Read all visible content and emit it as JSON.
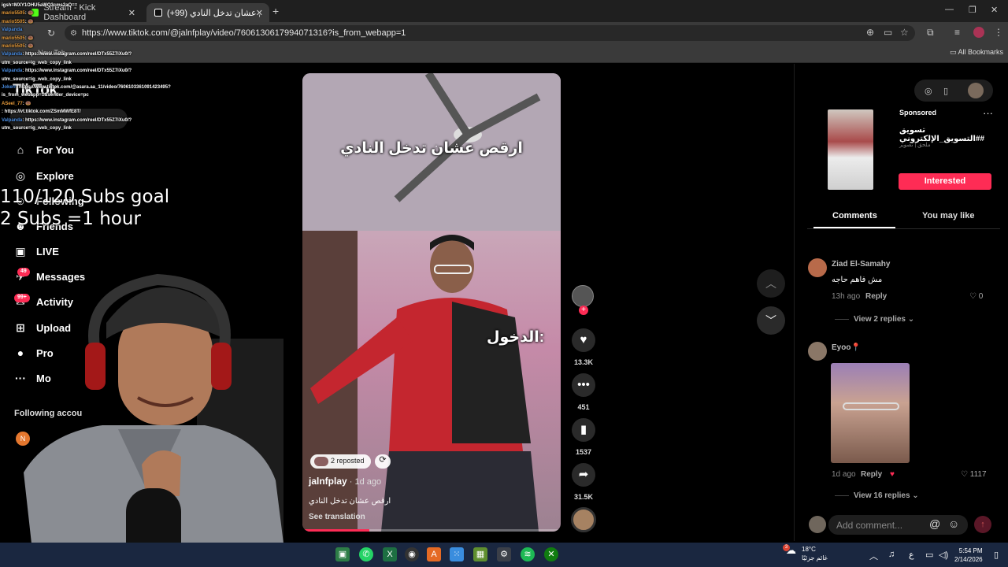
{
  "browser": {
    "tabs": [
      {
        "title": "Stream - Kick Dashboard",
        "favicon_color": "#53fc18"
      },
      {
        "title": "ارقص عشان تدخل النادي (99+) |",
        "favicon_color": "#111111"
      }
    ],
    "url": "https://www.tiktok.com/@jalnfplay/video/7606130617994071316?is_from_webapp=1",
    "bookmarks": {
      "new_tab": "New Tab",
      "all": "All Bookmarks"
    }
  },
  "chat": [
    {
      "nick": "",
      "text": "igsh=MXY1OHU5aWQ3cms2aQ=="
    },
    {
      "nick": "mario5505",
      "text": ": 🍩"
    },
    {
      "nick": "mario5505",
      "text": ": 🍩"
    },
    {
      "nick": "Valpanda",
      "text": ""
    },
    {
      "nick": "mario5505",
      "text": ": 🍩"
    },
    {
      "nick": "mario5505",
      "text": ": 🍩"
    },
    {
      "nick": "Valpanda",
      "text": ": https://www.instagram.com/reel/DTx55Z7iXu0/?"
    },
    {
      "nick": "",
      "text": "utm_source=ig_web_copy_link"
    },
    {
      "nick": "Valpanda",
      "text": ": https://www.instagram.com/reel/DTx55Z7iXu0/?"
    },
    {
      "nick": "",
      "text": "utm_source=ig_web_copy_link"
    },
    {
      "nick": "Jokerr",
      "text": ": https://www.tiktok.com/@asara.aa_11/video/7606103361091423495?"
    },
    {
      "nick": "",
      "text": "is_from_webapp=1&sender_device=pc"
    },
    {
      "nick": "ASeel_77",
      "text": ": 🍩"
    },
    {
      "nick": "",
      "text": ": https://vt.tiktok.com/ZSmMWfE8T/"
    },
    {
      "nick": "Valpanda",
      "text": ": https://www.instagram.com/reel/DTx55Z7iXu0/?"
    },
    {
      "nick": "",
      "text": "utm_source=ig_web_copy_link"
    }
  ],
  "tiktok": {
    "logo": "TikTok",
    "nav": [
      {
        "label": "For You",
        "icon": "home-icon",
        "glyph": "⌂"
      },
      {
        "label": "Explore",
        "icon": "compass-icon",
        "glyph": "◎"
      },
      {
        "label": "Following",
        "icon": "following-icon",
        "glyph": "☺"
      },
      {
        "label": "Friends",
        "icon": "friends-icon",
        "glyph": "☻"
      },
      {
        "label": "LIVE",
        "icon": "live-icon",
        "glyph": "▣"
      },
      {
        "label": "Messages",
        "icon": "messages-icon",
        "glyph": "✈"
      },
      {
        "label": "Activity",
        "icon": "activity-icon",
        "glyph": "✉"
      },
      {
        "label": "Upload",
        "icon": "upload-icon",
        "glyph": "⊞"
      },
      {
        "label": "Pro",
        "icon": "profile-icon",
        "glyph": "●"
      },
      {
        "label": "Mo",
        "icon": "more-icon",
        "glyph": "···"
      }
    ],
    "badges": {
      "messages": "49",
      "activity": "99+"
    },
    "following_accounts_label": "Following accou",
    "following_avatar_initial": "N"
  },
  "overlay": {
    "subs_goal": "110/120 Subs goal",
    "subs_rate": "2 Subs =1 hour"
  },
  "video": {
    "caption_top": "ارقص عشان تدخل النادي",
    "caption_mid": "الدخول:",
    "repost_label": "2 reposted",
    "author": "jalnfplay",
    "ago": " · 1d ago",
    "description": "ارقص عشان تدخل النادي",
    "see_translation": "See translation",
    "progress_fraction": 0.26,
    "likes": "13.3K",
    "comments": "451",
    "bookmarks": "1537",
    "shares": "31.5K"
  },
  "ad": {
    "sponsored": "Sponsored",
    "title": "تسويق #التسويق_الإلكتروني#",
    "subtitle": "ملحق | تصوير",
    "cta": "Interested"
  },
  "panel_tabs": {
    "comments": "Comments",
    "you_may_like": "You may like"
  },
  "comments": [
    {
      "name": "Ziad El-Samahy",
      "text": "مش فاهم حاجه",
      "ago": "13h ago",
      "reply": "Reply",
      "likes": "0",
      "view_replies": "View 2 replies",
      "avatar_color": "#b86a4a"
    },
    {
      "name": "Eyoo📍",
      "text": "",
      "ago": "1d ago",
      "reply": "Reply",
      "likes": "1117",
      "view_replies": "View 16 replies",
      "avatar_color": "#8a7767"
    }
  ],
  "add_comment_placeholder": "Add comment...",
  "taskbar": {
    "weather_temp": "18°C",
    "weather_desc": "غائم جزئيًا",
    "weather_badge": "3",
    "lang": "ع",
    "time": "5:54 PM",
    "date": "2/14/2026"
  }
}
